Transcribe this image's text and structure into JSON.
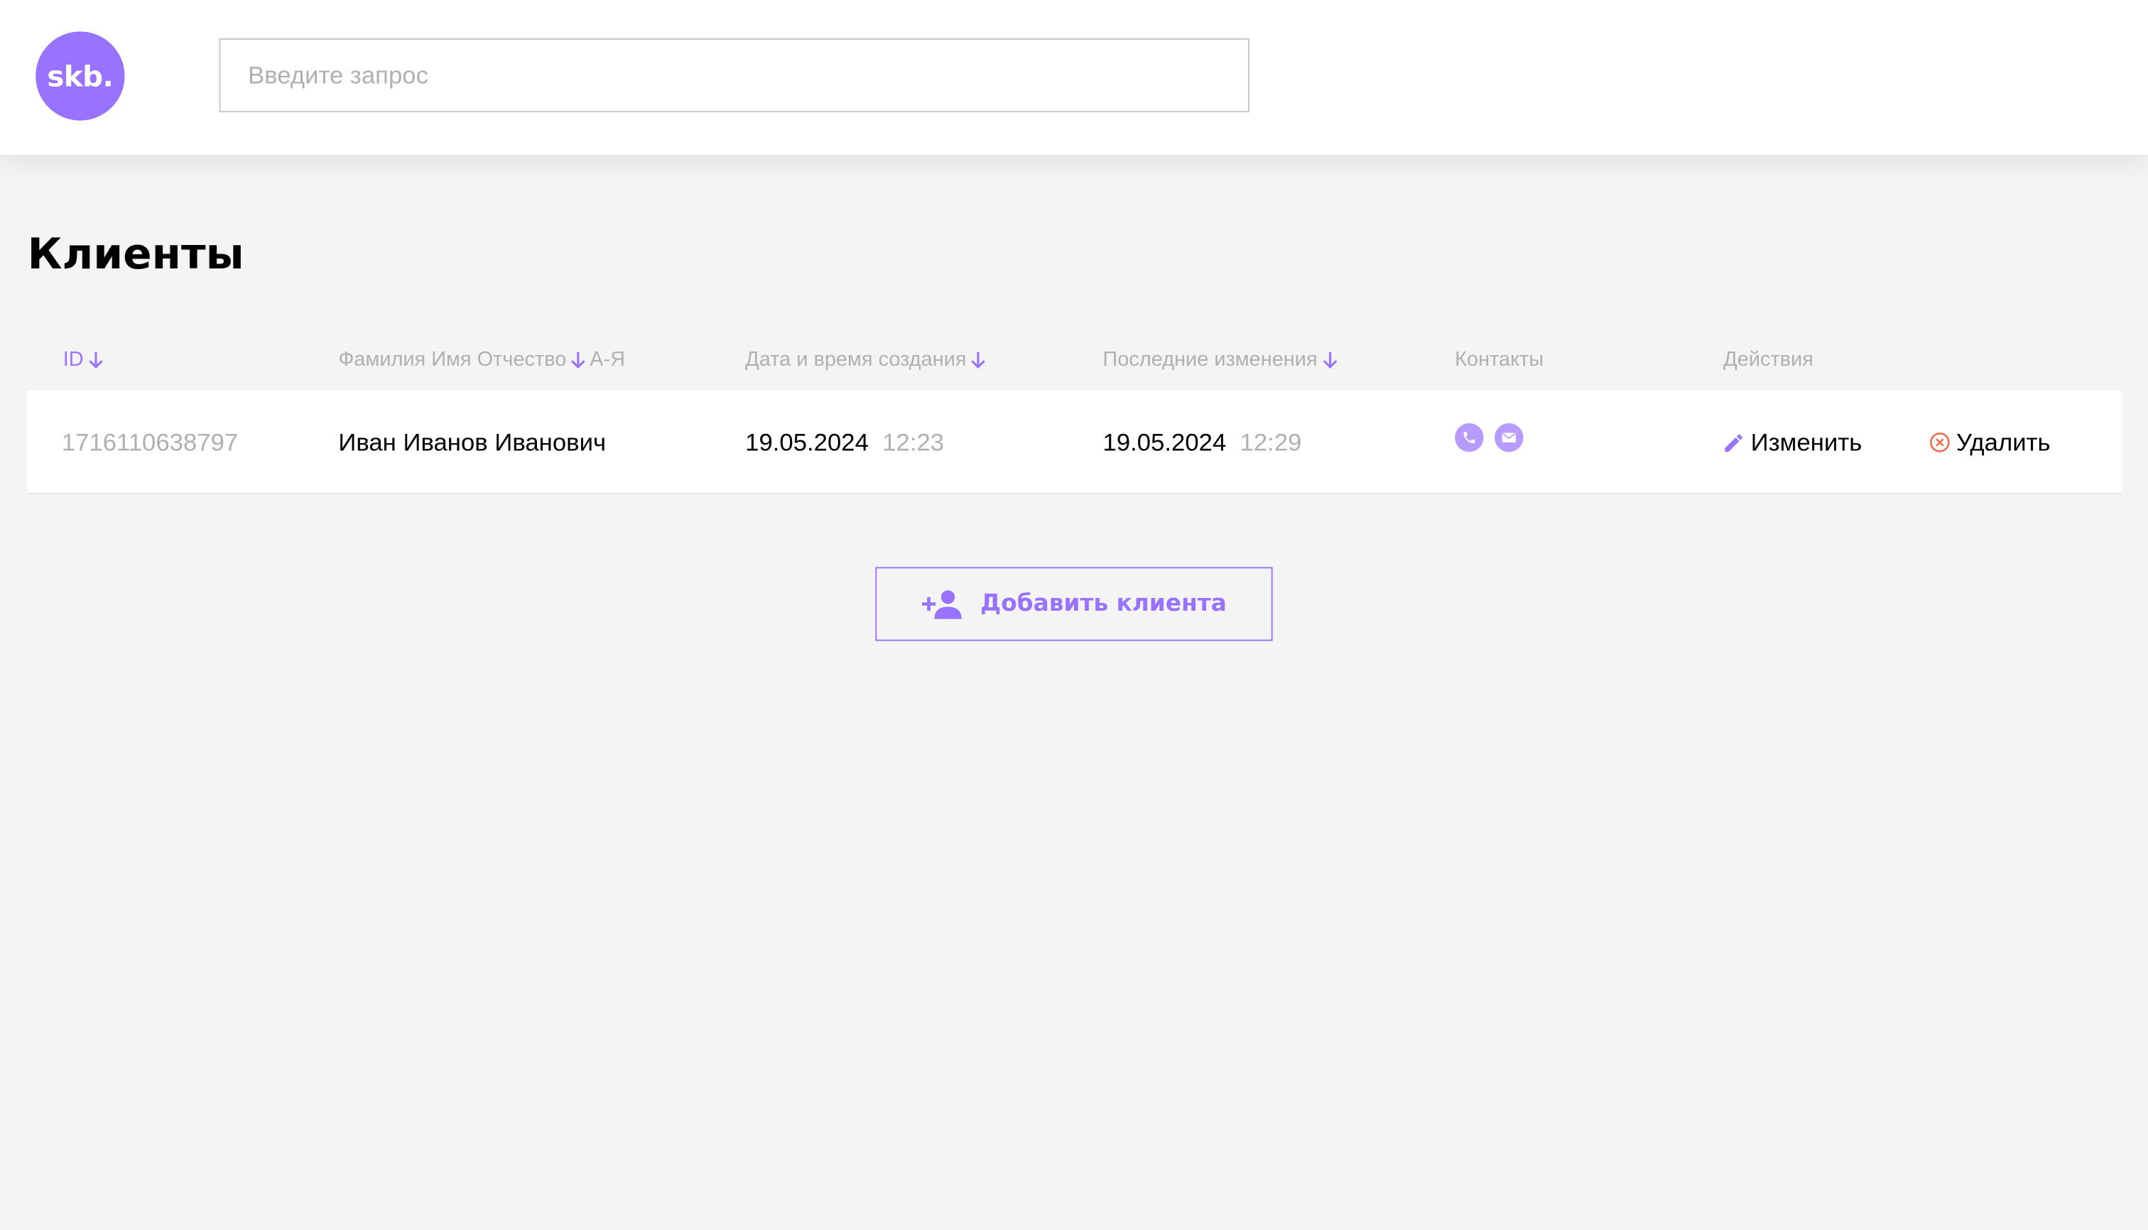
{
  "header": {
    "logo_text": "skb.",
    "search_placeholder": "Введите запрос"
  },
  "main": {
    "title": "Клиенты",
    "columns": {
      "id": "ID",
      "fio": "Фамилия Имя Отчество",
      "fio_sort": "А-Я",
      "created": "Дата и время создания",
      "updated": "Последние изменения",
      "contacts": "Контакты",
      "actions": "Действия"
    },
    "rows": [
      {
        "id": "1716110638797",
        "fio": "Иван Иванов Иванович",
        "created_date": "19.05.2024",
        "created_time": "12:23",
        "updated_date": "19.05.2024",
        "updated_time": "12:29",
        "contacts": [
          "phone-icon",
          "mail-icon"
        ],
        "edit_label": "Изменить",
        "delete_label": "Удалить"
      }
    ],
    "add_button_label": "Добавить клиента"
  },
  "colors": {
    "accent": "#9873ff",
    "contact_icon": "#b89bff",
    "delete_icon": "#f06a4d",
    "muted_text": "#b0b0b0",
    "background": "#f4f4f4"
  }
}
